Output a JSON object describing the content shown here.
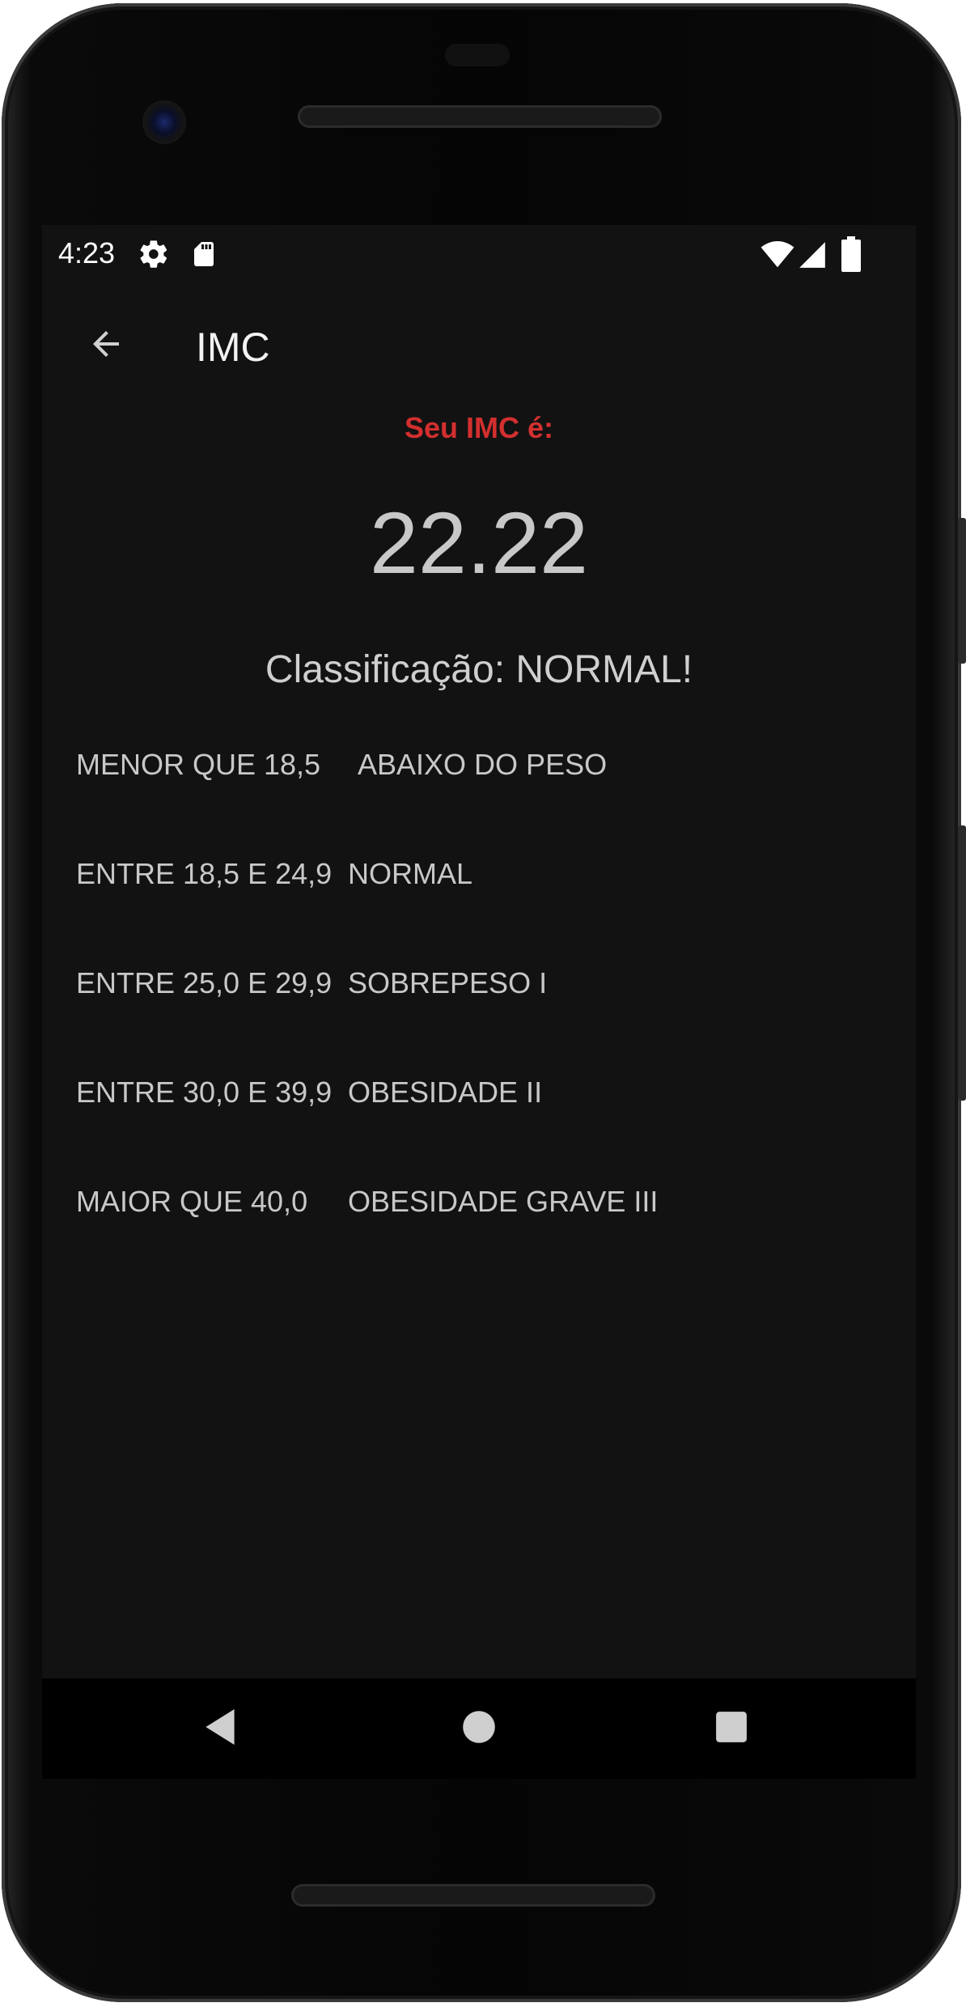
{
  "status_bar": {
    "time": "4:23",
    "icons": [
      "gear-icon",
      "sd-card-icon",
      "wifi-icon",
      "signal-icon",
      "battery-icon"
    ]
  },
  "app_bar": {
    "title": "IMC",
    "back_icon": "arrow-left-icon"
  },
  "result": {
    "label": "Seu IMC é:",
    "value": "22.22",
    "classification": "Classificação: NORMAL!"
  },
  "table": {
    "rows": [
      {
        "range": "MENOR QUE 18,5",
        "classification": "ABAIXO DO PESO"
      },
      {
        "range": "ENTRE 18,5 E 24,9",
        "classification": "NORMAL"
      },
      {
        "range": "ENTRE 25,0 E 29,9",
        "classification": "SOBREPESO I"
      },
      {
        "range": "ENTRE 30,0 E 39,9",
        "classification": "OBESIDADE II"
      },
      {
        "range": "MAIOR QUE 40,0",
        "classification": "OBESIDADE GRAVE III"
      }
    ]
  },
  "nav_bar": {
    "icons": [
      "nav-back-icon",
      "nav-home-icon",
      "nav-recent-icon"
    ]
  },
  "colors": {
    "background": "#121212",
    "accent_red": "#d32f2f",
    "text": "#c8c8c8"
  }
}
